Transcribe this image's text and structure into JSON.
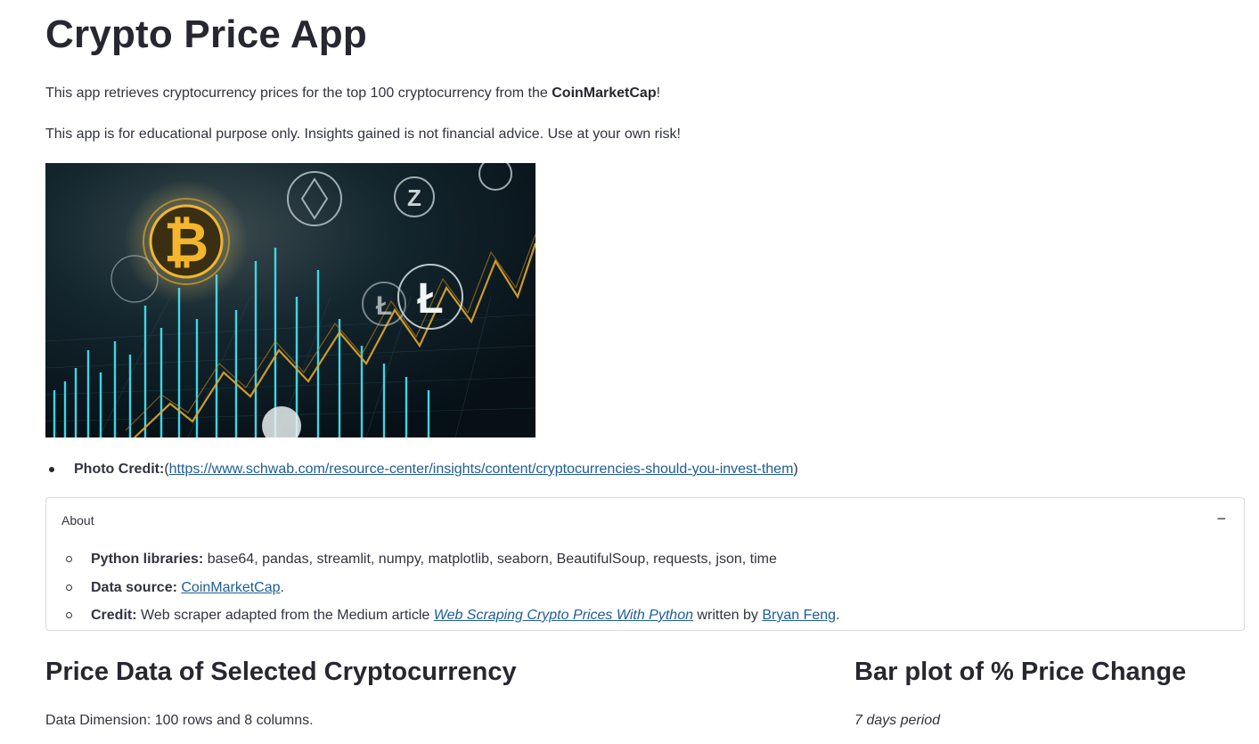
{
  "page": {
    "title": "Crypto Price App",
    "intro_prefix": "This app retrieves cryptocurrency prices for the top 100 cryptocurrency from the ",
    "intro_bold": "CoinMarketCap",
    "intro_suffix": "!",
    "disclaimer": "This app is for educational purpose only. Insights gained is not financial advice. Use at your own risk!"
  },
  "photo_credit": {
    "label": "Photo Credit:",
    "open_paren": "(",
    "url": "https://www.schwab.com/resource-center/insights/content/cryptocurrencies-should-you-invest-them",
    "close_paren": ")"
  },
  "about": {
    "header": "About",
    "toggle": "−",
    "libraries_label": "Python libraries:",
    "libraries_value": " base64, pandas, streamlit, numpy, matplotlib, seaborn, BeautifulSoup, requests, json, time",
    "source_label": "Data source:",
    "source_link": "CoinMarketCap",
    "source_suffix": ".",
    "credit_label": "Credit:",
    "credit_prefix": " Web scraper adapted from the Medium article ",
    "credit_article": "Web Scraping Crypto Prices With Python",
    "credit_mid": " written by ",
    "credit_author": "Bryan Feng",
    "credit_suffix": "."
  },
  "price_section": {
    "heading": "Price Data of Selected Cryptocurrency",
    "dimension": "Data Dimension: 100 rows and 8 columns."
  },
  "bar_section": {
    "heading": "Bar plot of % Price Change",
    "period": "7 days period"
  },
  "colors": {
    "link": "#1f5c99",
    "text": "#31333f",
    "heading": "#262730",
    "border": "#d9dadf"
  }
}
